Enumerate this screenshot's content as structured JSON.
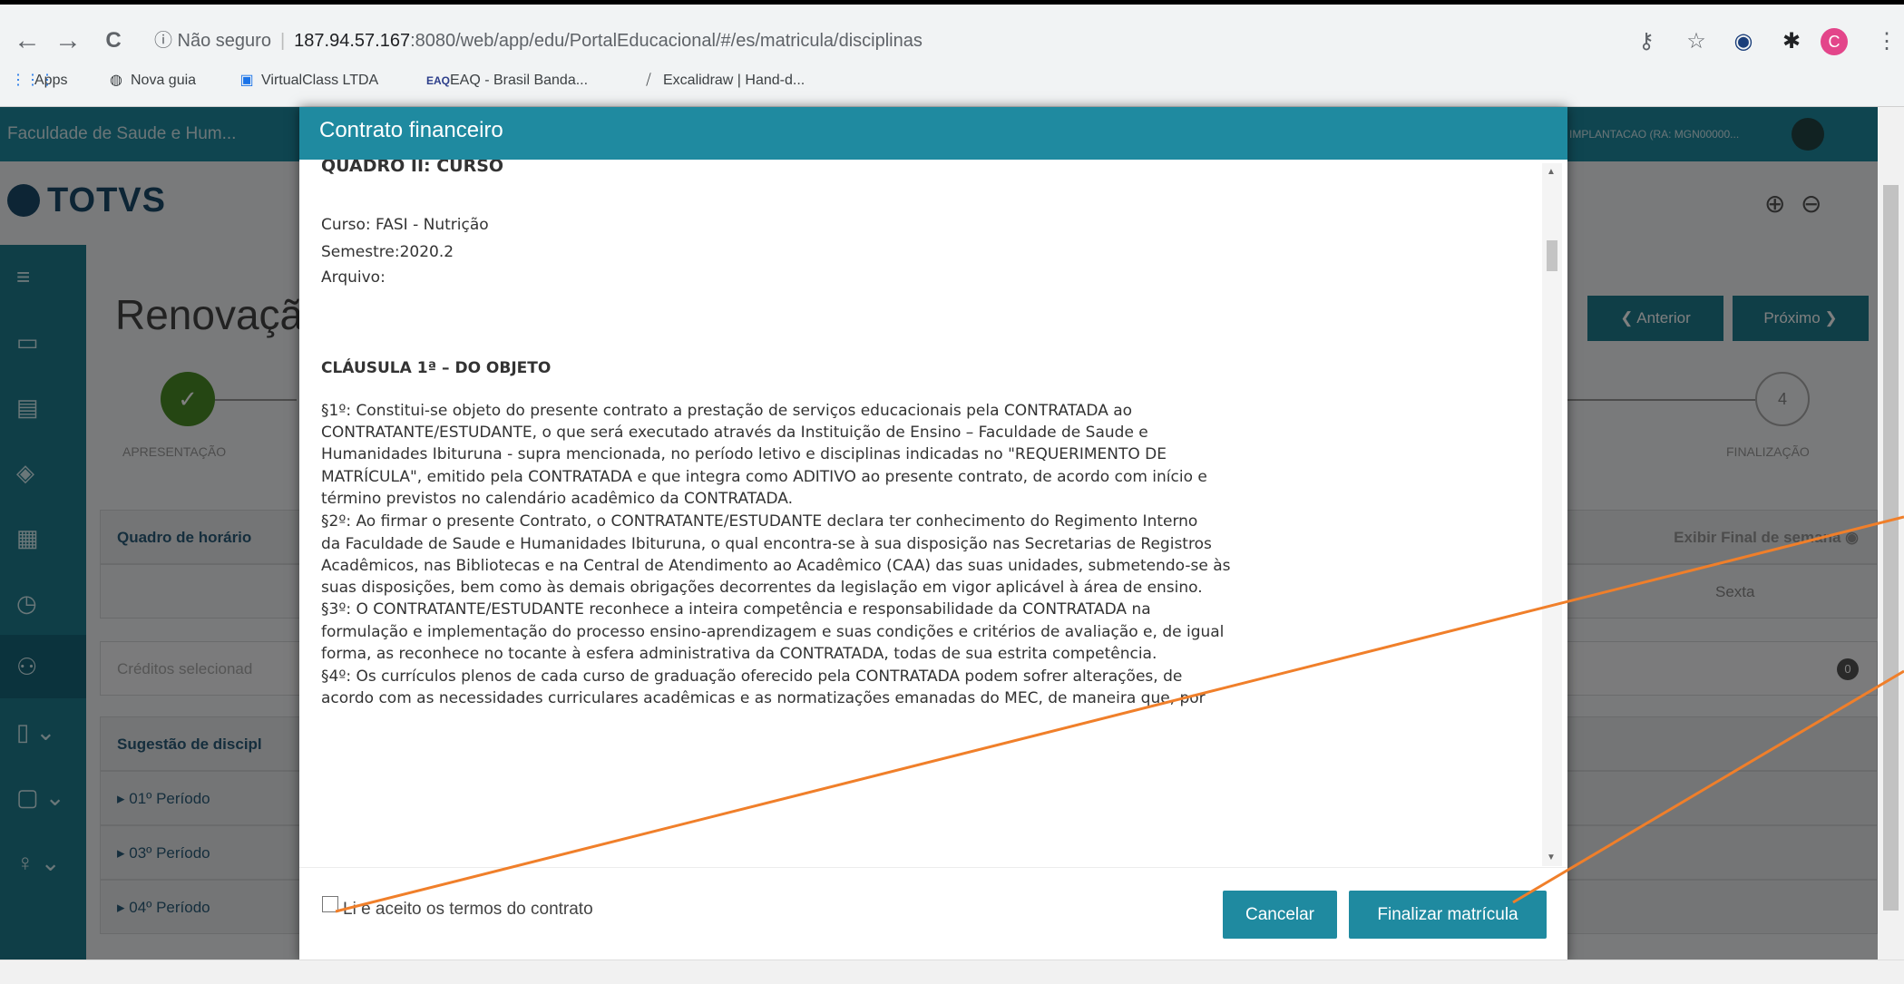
{
  "browser": {
    "nav": {
      "back": "←",
      "forward": "→",
      "reload": "C"
    },
    "security": "ⓘ Não seguro",
    "url_host": "187.94.57.167",
    "url_rest": ":8080/web/app/edu/PortalEducacional/#/es/matricula/disciplinas",
    "bookmarks": [
      "Apps",
      "Nova guia",
      "VirtualClass LTDA",
      "EAQ - Brasil Banda...",
      "Excalidraw | Hand-d..."
    ]
  },
  "app": {
    "institution": "Faculdade de Saude e Hum...",
    "user": "IMPLANTACAO (RA: MGN00000...",
    "logo": "TOTVS",
    "page_title": "Renovaçã",
    "prev_label": "❮ Anterior",
    "next_label": "Próximo ❯",
    "step1_label": "APRESENTAÇÃO",
    "step4_number": "4",
    "step4_label": "FINALIZAÇÃO",
    "rows": {
      "schedule": "Quadro de horário",
      "schedule_right": "Exibir Final de semana",
      "friday": "Sexta",
      "credits": "Créditos selecionad",
      "credits_count": "0",
      "suggest": "Sugestão de discipl",
      "p1": "▸ 01º Período",
      "p3": "▸ 03º Período",
      "p4": "▸ 04º Período"
    }
  },
  "modal": {
    "title": "Contrato financeiro",
    "lines": {
      "l0": "QUADRO II: CURSO",
      "l1": "Curso: FASI - Nutrição",
      "l2": "Semestre:2020.2",
      "l3": "Arquivo:",
      "l4": "CLÁUSULA 1ª – DO OBJETO",
      "l5": "§1º: Constitui-se objeto do presente contrato a prestação de serviços educacionais pela CONTRATADA ao",
      "l6": "CONTRATANTE/ESTUDANTE, o que será executado através da Instituição de Ensino – Faculdade de Saude e",
      "l7": "Humanidades Ibituruna - supra mencionada, no período letivo e disciplinas indicadas no \"REQUERIMENTO DE",
      "l8": "MATRÍCULA\", emitido pela CONTRATADA e que integra como ADITIVO ao presente contrato, de acordo com início e",
      "l9": "término previstos no calendário acadêmico da CONTRATADA.",
      "l10": "§2º: Ao firmar o presente Contrato, o CONTRATANTE/ESTUDANTE declara ter conhecimento do Regimento Interno",
      "l11": "da Faculdade de Saude e Humanidades Ibituruna, o qual encontra-se à sua disposição nas Secretarias de Registros",
      "l12": "Acadêmicos, nas Bibliotecas e na Central de Atendimento ao Acadêmico (CAA) das suas unidades, submetendo-se às",
      "l13": "suas disposições, bem como às demais obrigações decorrentes da legislação em vigor aplicável à área de ensino.",
      "l14": "§3º: O CONTRATANTE/ESTUDANTE reconhece a inteira competência e responsabilidade da CONTRATADA na",
      "l15": "formulação e implementação do processo ensino-aprendizagem e suas condições e critérios de avaliação e, de igual",
      "l16": "forma, as reconhece no tocante à esfera administrativa da CONTRATADA, todas de sua estrita competência.",
      "l17": "§4º: Os currículos plenos de cada curso de graduação oferecido pela CONTRATADA podem sofrer alterações, de",
      "l18": "acordo com as necessidades curriculares acadêmicas e as normatizações emanadas do MEC, de maneira que, por"
    },
    "accept_label": "Li e aceito os termos do contrato",
    "cancel_label": "Cancelar",
    "finalize_label": "Finalizar matrícula"
  },
  "colors": {
    "accent": "#1f8aa0",
    "annotation": "#f07f2a"
  }
}
